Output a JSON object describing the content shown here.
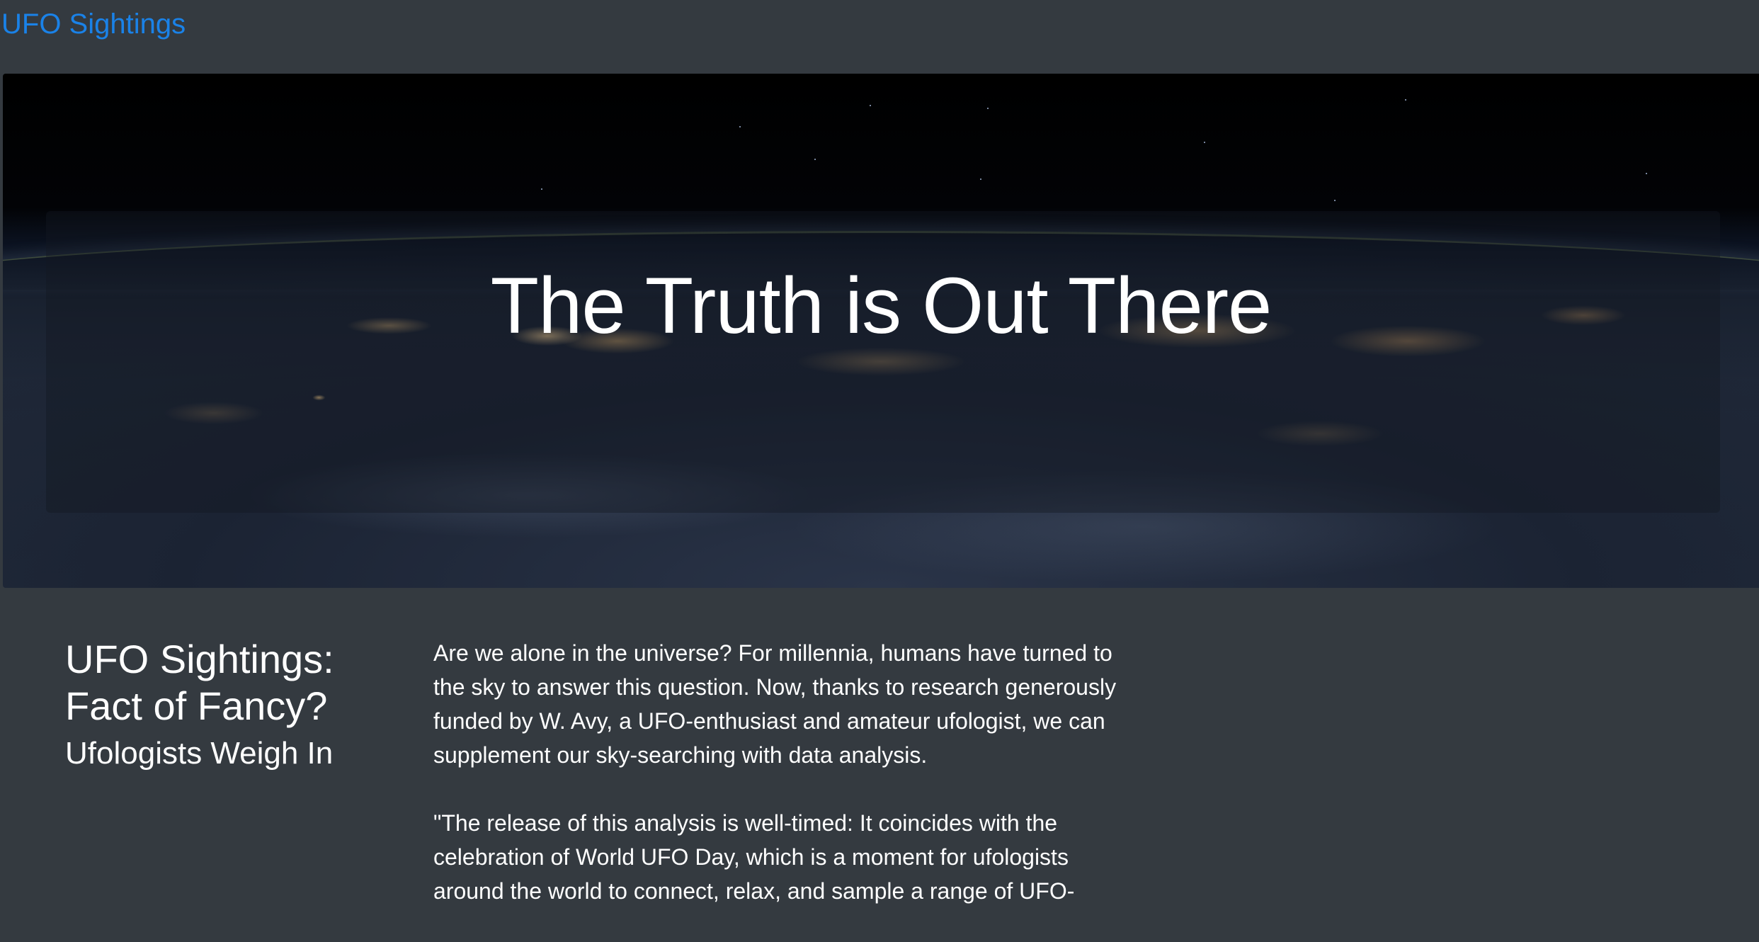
{
  "navbar": {
    "brand": "UFO Sightings"
  },
  "hero": {
    "title": "The Truth is Out There"
  },
  "article": {
    "headline": "UFO Sightings: Fact of Fancy?",
    "subheadline": "Ufologists Weigh In",
    "paragraphs": [
      "Are we alone in the universe? For millennia, humans have turned to the sky to answer this question. Now, thanks to research generously funded by W. Avy, a UFO-enthusiast and amateur ufologist, we can supplement our sky-searching with data analysis.",
      "\"The release of this analysis is well-timed: It coincides with the celebration of World UFO Day, which is a moment for ufologists around the world to connect, relax, and sample a range of UFO-"
    ]
  }
}
